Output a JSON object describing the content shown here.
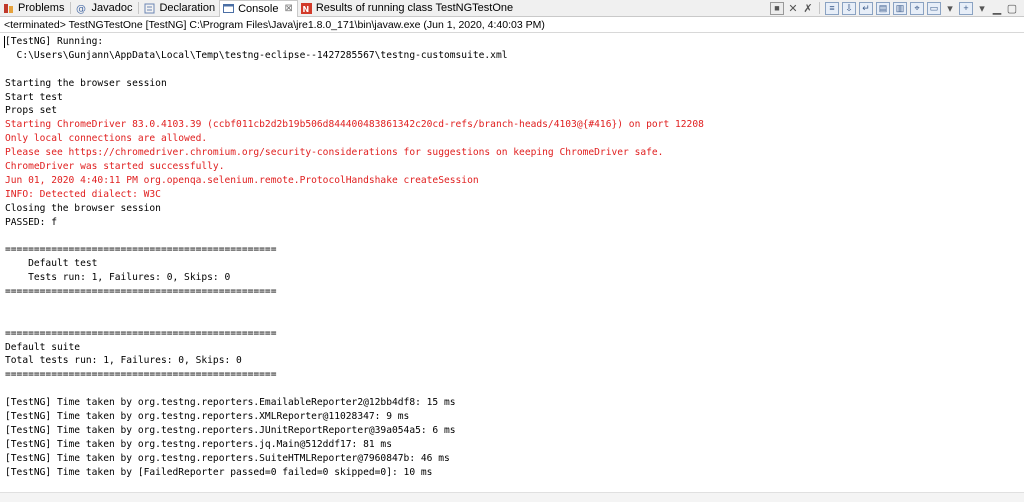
{
  "tabs": [
    {
      "label": "Problems",
      "icon": "problems-icon",
      "active": false
    },
    {
      "label": "Javadoc",
      "icon": "javadoc-icon",
      "active": false
    },
    {
      "label": "Declaration",
      "icon": "declaration-icon",
      "active": false
    },
    {
      "label": "Console",
      "icon": "console-icon",
      "active": true,
      "close": "⊠"
    },
    {
      "label": "Results of running class TestNGTestOne",
      "icon": "testng-icon",
      "active": false
    }
  ],
  "status_line": "<terminated> TestNGTestOne [TestNG] C:\\Program Files\\Java\\jre1.8.0_171\\bin\\javaw.exe (Jun 1, 2020, 4:40:03 PM)",
  "console_lines": [
    {
      "text": "[TestNG] Running:",
      "color": "black"
    },
    {
      "text": "  C:\\Users\\Gunjann\\AppData\\Local\\Temp\\testng-eclipse--1427285567\\testng-customsuite.xml",
      "color": "black"
    },
    {
      "text": "",
      "color": "black"
    },
    {
      "text": "Starting the browser session",
      "color": "black"
    },
    {
      "text": "Start test",
      "color": "black"
    },
    {
      "text": "Props set",
      "color": "black"
    },
    {
      "text": "Starting ChromeDriver 83.0.4103.39 (ccbf011cb2d2b19b506d844400483861342c20cd-refs/branch-heads/4103@{#416}) on port 12208",
      "color": "red"
    },
    {
      "text": "Only local connections are allowed.",
      "color": "red"
    },
    {
      "text": "Please see https://chromedriver.chromium.org/security-considerations for suggestions on keeping ChromeDriver safe.",
      "color": "red"
    },
    {
      "text": "ChromeDriver was started successfully.",
      "color": "red"
    },
    {
      "text": "Jun 01, 2020 4:40:11 PM org.openqa.selenium.remote.ProtocolHandshake createSession",
      "color": "red"
    },
    {
      "text": "INFO: Detected dialect: W3C",
      "color": "red"
    },
    {
      "text": "Closing the browser session",
      "color": "black"
    },
    {
      "text": "PASSED: f",
      "color": "black"
    },
    {
      "text": "",
      "color": "black"
    },
    {
      "text": "===============================================",
      "color": "black"
    },
    {
      "text": "    Default test",
      "color": "black"
    },
    {
      "text": "    Tests run: 1, Failures: 0, Skips: 0",
      "color": "black"
    },
    {
      "text": "===============================================",
      "color": "black"
    },
    {
      "text": "",
      "color": "black"
    },
    {
      "text": "",
      "color": "black"
    },
    {
      "text": "===============================================",
      "color": "black"
    },
    {
      "text": "Default suite",
      "color": "black"
    },
    {
      "text": "Total tests run: 1, Failures: 0, Skips: 0",
      "color": "black"
    },
    {
      "text": "===============================================",
      "color": "black"
    },
    {
      "text": "",
      "color": "black"
    },
    {
      "text": "[TestNG] Time taken by org.testng.reporters.EmailableReporter2@12bb4df8: 15 ms",
      "color": "black"
    },
    {
      "text": "[TestNG] Time taken by org.testng.reporters.XMLReporter@11028347: 9 ms",
      "color": "black"
    },
    {
      "text": "[TestNG] Time taken by org.testng.reporters.JUnitReportReporter@39a054a5: 6 ms",
      "color": "black"
    },
    {
      "text": "[TestNG] Time taken by org.testng.reporters.jq.Main@512ddf17: 81 ms",
      "color": "black"
    },
    {
      "text": "[TestNG] Time taken by org.testng.reporters.SuiteHTMLReporter@7960847b: 46 ms",
      "color": "black"
    },
    {
      "text": "[TestNG] Time taken by [FailedReporter passed=0 failed=0 skipped=0]: 10 ms",
      "color": "black"
    }
  ],
  "colors": {
    "error_text": "#e02020",
    "normal_text": "#000000"
  }
}
